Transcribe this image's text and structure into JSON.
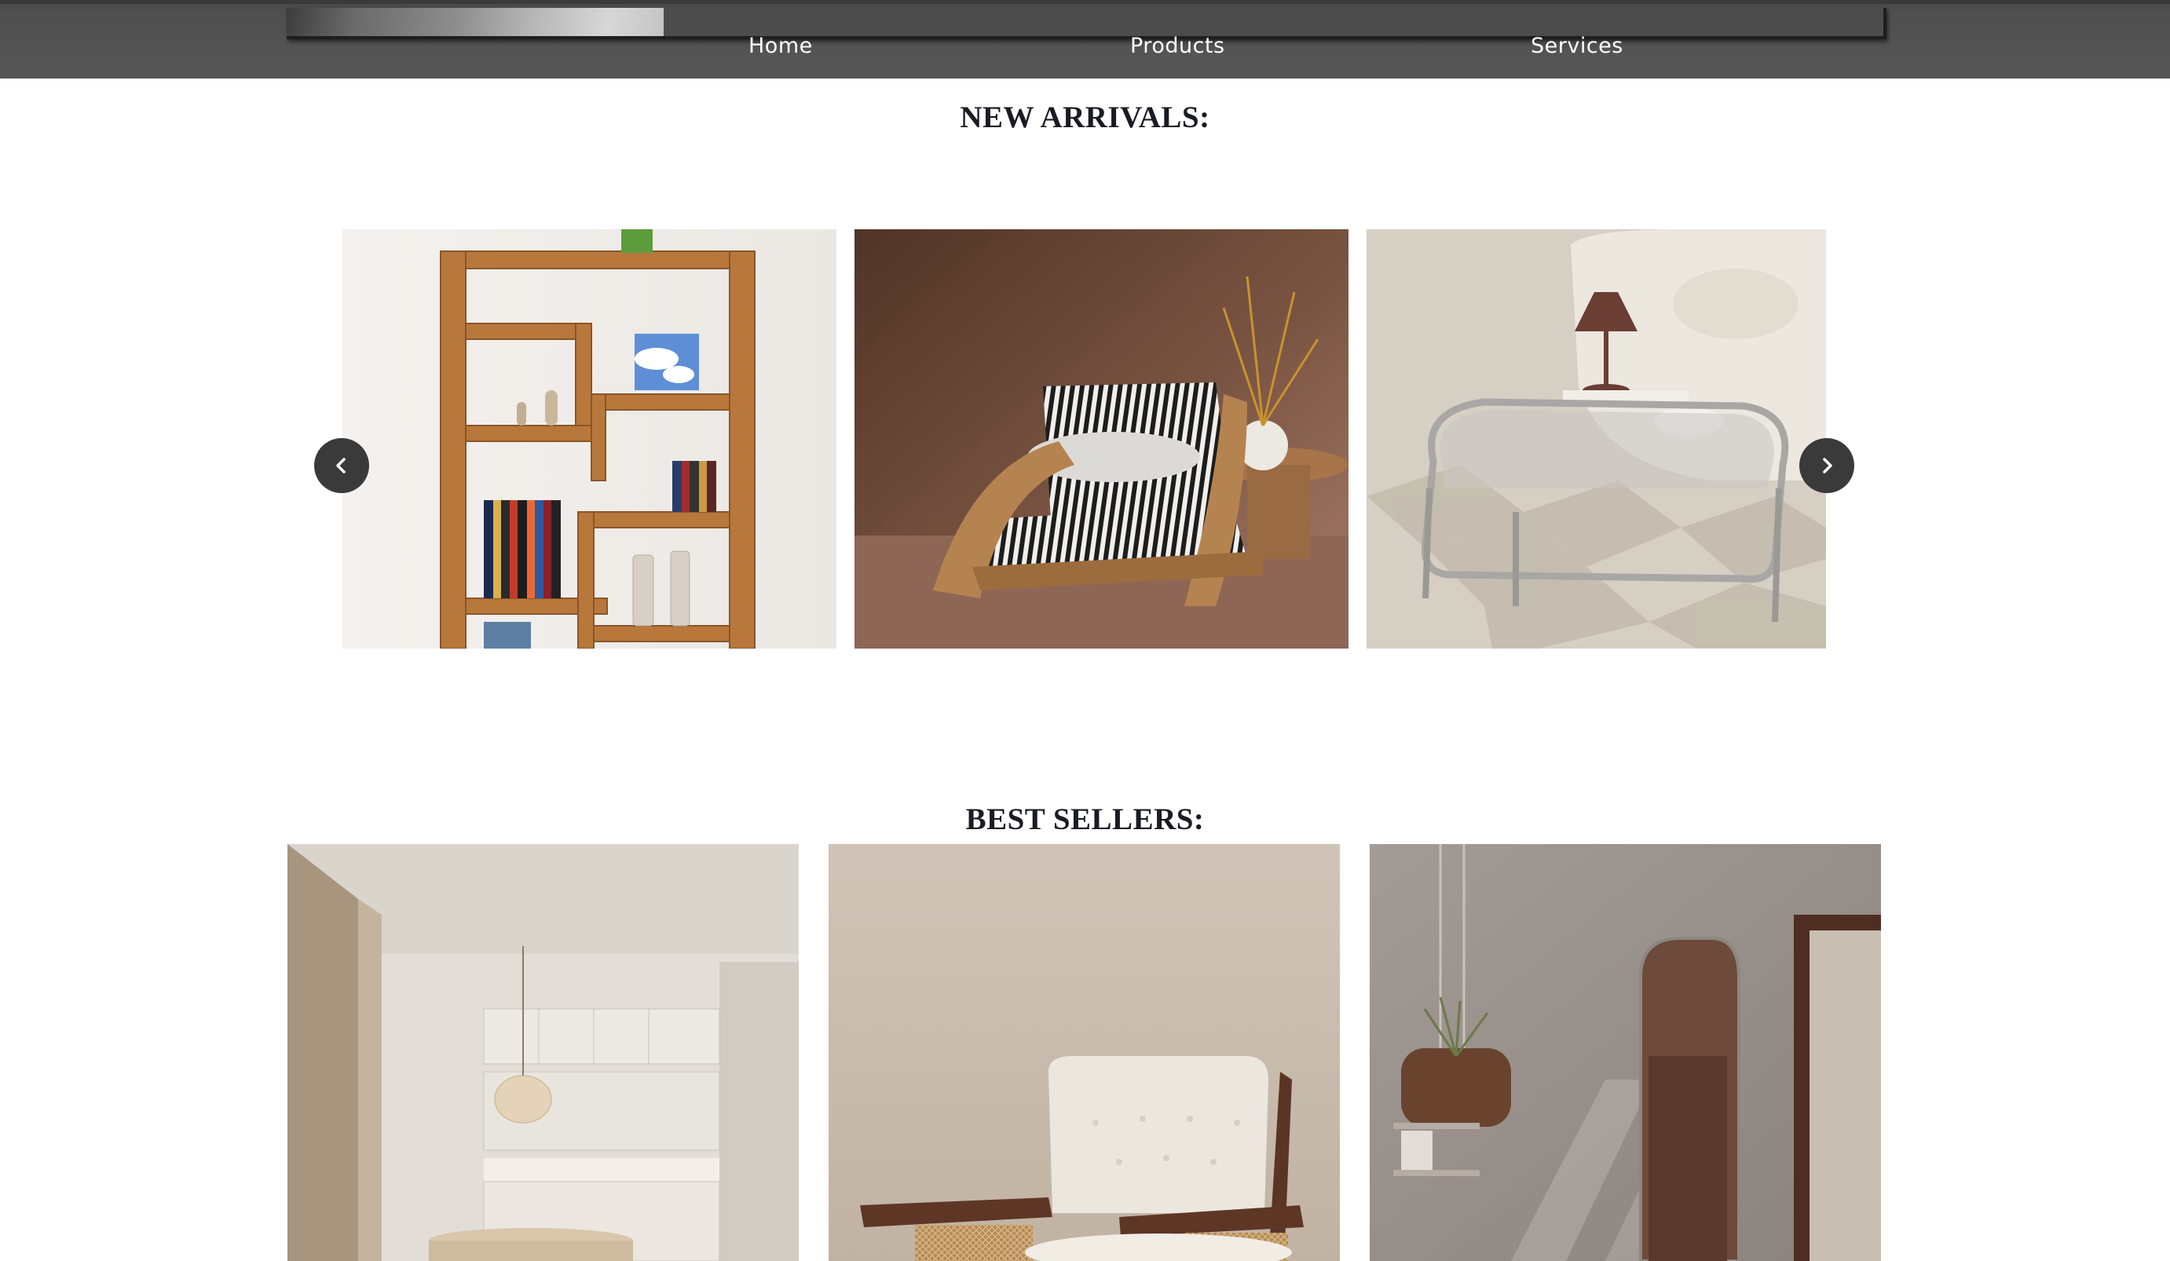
{
  "nav": {
    "links": [
      "Home",
      "Products",
      "Services"
    ]
  },
  "sections": {
    "new_arrivals_title": "NEW ARRIVALS:",
    "best_sellers_title": "BEST SELLERS:"
  },
  "carousel": {
    "items": [
      "bookshelf-image",
      "striped-armchair-image",
      "glass-coffee-table-image"
    ],
    "prev_icon": "chevron-left-icon",
    "next_icon": "chevron-right-icon"
  },
  "best_sellers": {
    "items": [
      "kitchen-interior-image",
      "cane-armchair-image",
      "hallway-mirror-image"
    ]
  },
  "colors": {
    "navbar": "#555555",
    "heading": "#1b1b24",
    "carousel_button": "#3a3a3a"
  }
}
